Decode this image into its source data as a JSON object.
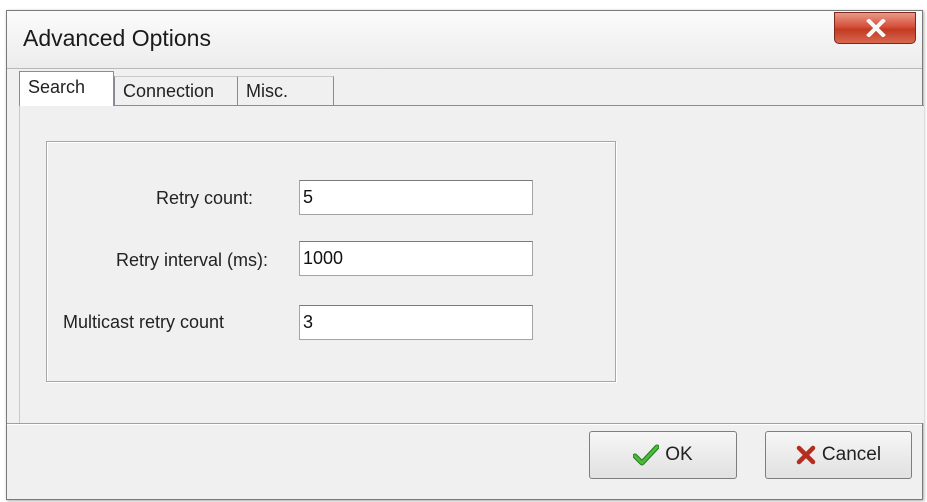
{
  "window": {
    "title": "Advanced Options",
    "close_icon": "close-icon"
  },
  "tabs": [
    {
      "label": "Search",
      "active": true
    },
    {
      "label": "Connection",
      "active": false
    },
    {
      "label": "Misc.",
      "active": false
    }
  ],
  "search": {
    "retry_count": {
      "label": "Retry count:",
      "value": "5"
    },
    "retry_interval": {
      "label": "Retry interval (ms):",
      "value": "1000"
    },
    "multicast_retry_count": {
      "label": "Multicast retry count",
      "value": "3"
    }
  },
  "buttons": {
    "ok": {
      "label": "OK",
      "icon": "checkmark-icon",
      "icon_color": "#2e9a2e"
    },
    "cancel": {
      "label": "Cancel",
      "icon": "x-mark-icon",
      "icon_color": "#c0392b"
    }
  },
  "colors": {
    "close_button": "#c9432b",
    "dialog_background": "#f0f0f0"
  }
}
